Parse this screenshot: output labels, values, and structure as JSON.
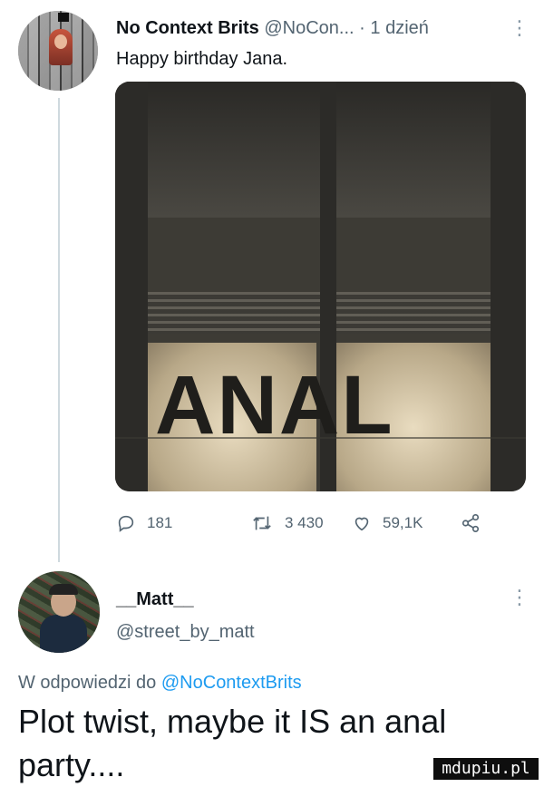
{
  "tweet": {
    "author_name": "No Context Brits",
    "author_handle": "@NoCon...",
    "separator": "·",
    "time": "1 dzień",
    "text": "Happy birthday Jana.",
    "media_caption": "ANAL",
    "actions": {
      "replies": "181",
      "retweets": "3 430",
      "likes": "59,1K"
    }
  },
  "reply": {
    "author_name": "__Matt__",
    "author_handle": "@street_by_matt",
    "reply_prefix": "W odpowiedzi do",
    "reply_to": "@NoContextBrits",
    "text": "Plot twist, maybe it IS an anal party...."
  },
  "watermark": "mdupiu.pl",
  "icons": {
    "more": "more-vertical-icon",
    "reply": "reply-icon",
    "retweet": "retweet-icon",
    "like": "heart-icon",
    "share": "share-icon"
  },
  "colors": {
    "text": "#0f1419",
    "secondary": "#536471",
    "link": "#1d9bf0",
    "thread_line": "#cfd9de"
  }
}
